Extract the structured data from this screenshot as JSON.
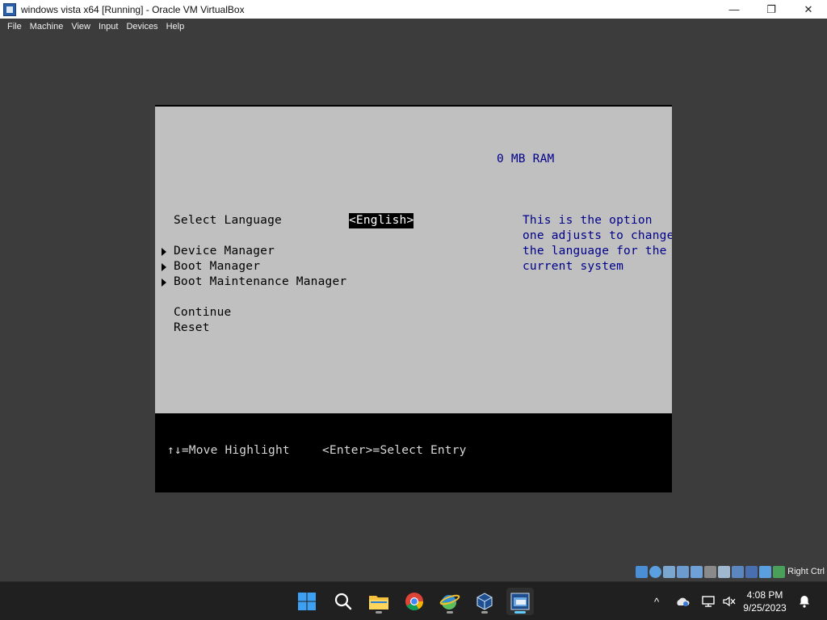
{
  "window": {
    "title": "windows vista x64 [Running] - Oracle VM VirtualBox",
    "minimize": "—",
    "maximize": "❐",
    "close": "✕"
  },
  "menu": [
    "File",
    "Machine",
    "View",
    "Input",
    "Devices",
    "Help"
  ],
  "vm": {
    "ram": "0 MB RAM",
    "language_label": "Select Language",
    "language_value": "<English>",
    "menu_items": [
      "Device Manager",
      "Boot Manager",
      "Boot Maintenance Manager"
    ],
    "continue": "Continue",
    "reset": "Reset",
    "help_lines": [
      "This is the option",
      "one adjusts to change",
      "the language for the",
      "current system"
    ],
    "footer_move": "↑↓=Move Highlight",
    "footer_select": "<Enter>=Select Entry"
  },
  "statusbar": {
    "host_key": "Right Ctrl",
    "icons": [
      "hard-disk-icon",
      "optical-drive-icon",
      "audio-icon",
      "network-icon",
      "usb-icon",
      "shared-folders-icon",
      "display-icon",
      "video-capture-icon",
      "cpu-icon",
      "mouse-integration-icon",
      "keyboard-icon"
    ]
  },
  "taskbar": {
    "apps": [
      "start-icon",
      "search-icon",
      "file-explorer-icon",
      "chrome-icon",
      "edge-icon",
      "virtualbox-icon",
      "vista-vm-icon"
    ],
    "time": "4:08 PM",
    "date": "9/25/2023",
    "tray_chevron": "^"
  }
}
